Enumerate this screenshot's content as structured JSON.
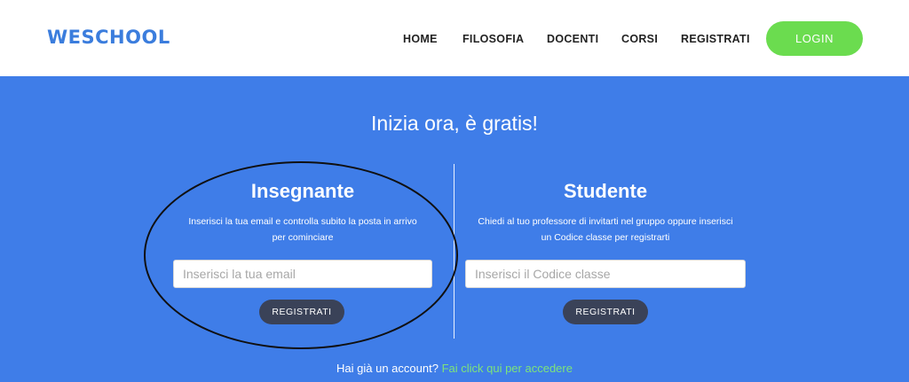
{
  "header": {
    "logo": "WESCHOOL",
    "nav": [
      "HOME",
      "FILOSOFIA",
      "DOCENTI",
      "CORSI",
      "REGISTRATI"
    ],
    "login_label": "LOGIN"
  },
  "hero": {
    "title": "Inizia ora, è gratis!"
  },
  "teacher": {
    "title": "Insegnante",
    "desc_line1": "Inserisci la tua email e controlla subito la posta in arrivo",
    "desc_line2": "per cominciare",
    "input_placeholder": "Inserisci la tua email",
    "button_label": "REGISTRATI"
  },
  "student": {
    "title": "Studente",
    "desc_line1": "Chiedi al tuo professore di invitarti nel gruppo oppure inserisci",
    "desc_line2": "un Codice classe per registrarti",
    "input_placeholder": "Inserisci il Codice classe",
    "button_label": "REGISTRATI"
  },
  "footer": {
    "text": "Hai già un account?",
    "link": "Fai click qui per accedere"
  },
  "colors": {
    "brand_blue": "#3f7de8",
    "login_green": "#6bdc4f",
    "button_dark": "#3a4258",
    "link_green": "#7de47a"
  }
}
